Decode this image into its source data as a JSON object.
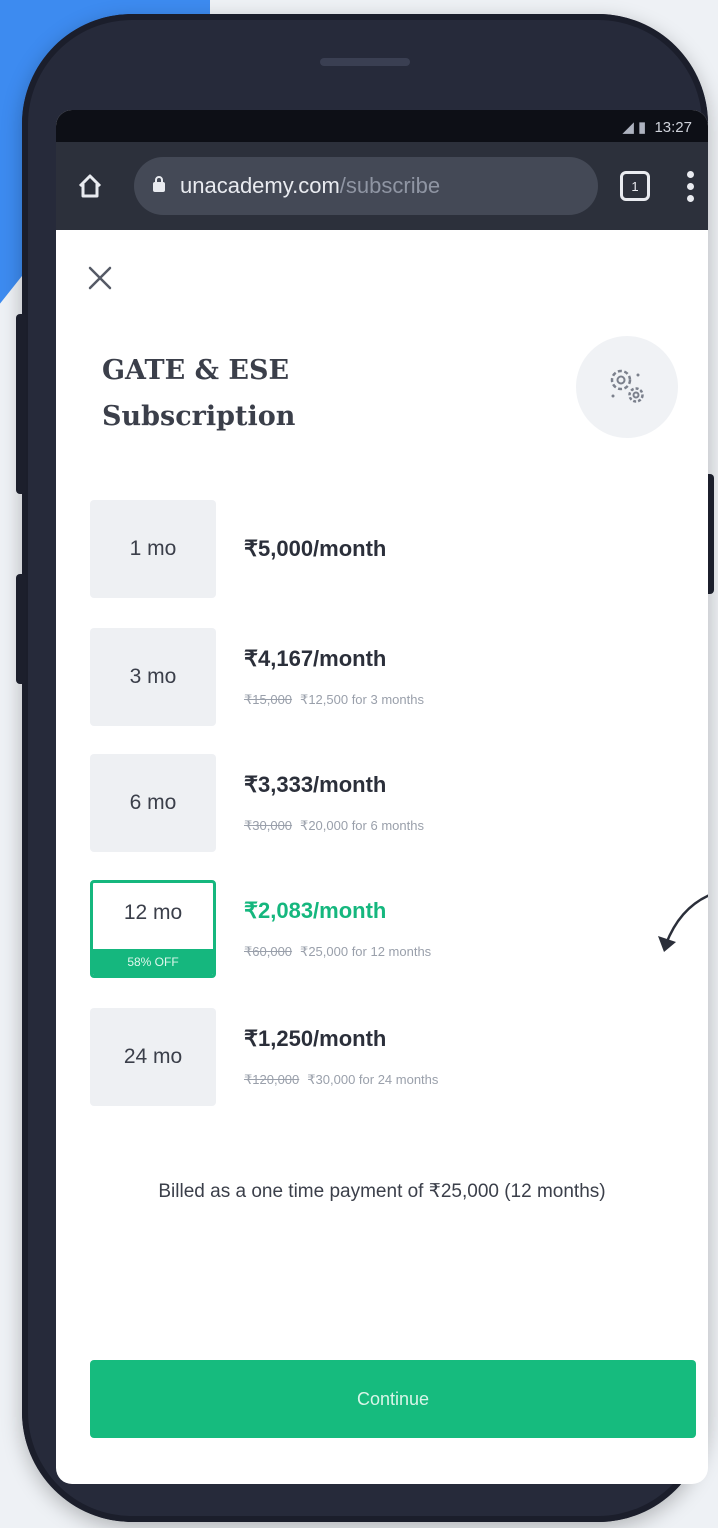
{
  "statusbar": {
    "time": "13:27"
  },
  "browser": {
    "url_domain": "unacademy.com",
    "url_path": "/subscribe",
    "tab_count": "1"
  },
  "page": {
    "title_line1": "GATE & ESE",
    "title_line2": "Subscription"
  },
  "plans": [
    {
      "duration": "1 mo",
      "price": "₹5,000/month",
      "original": "",
      "total": ""
    },
    {
      "duration": "3 mo",
      "price": "₹4,167/month",
      "original": "₹15,000",
      "total": "₹12,500 for 3 months"
    },
    {
      "duration": "6 mo",
      "price": "₹3,333/month",
      "original": "₹30,000",
      "total": "₹20,000 for 6 months"
    },
    {
      "duration": "12 mo",
      "price": "₹2,083/month",
      "original": "₹60,000",
      "total": "₹25,000 for 12 months",
      "badge": "58% OFF",
      "selected": true
    },
    {
      "duration": "24 mo",
      "price": "₹1,250/month",
      "original": "₹120,000",
      "total": "₹30,000 for 24 months"
    }
  ],
  "billing_note": "Billed as a one time payment of ₹25,000 (12 months)",
  "continue_label": "Continue",
  "colors": {
    "accent": "#15b77e",
    "browser_bar": "#2c303b",
    "deco_blue": "#3d8bf0"
  }
}
